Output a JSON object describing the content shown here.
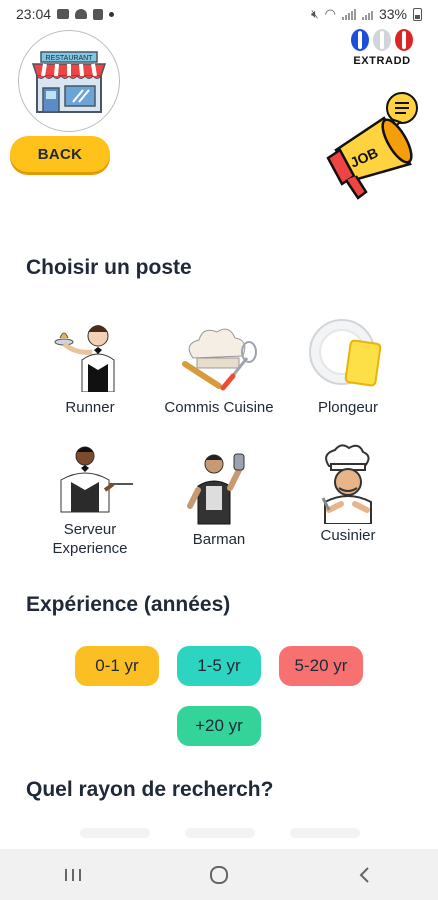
{
  "status_bar": {
    "time": "23:04",
    "battery": "33%"
  },
  "header": {
    "logo_sign": "RESTAURANT",
    "back_label": "BACK",
    "brand_name": "EXTRADD",
    "megaphone_text": "JOB"
  },
  "positions": {
    "title": "Choisir un poste",
    "items": [
      {
        "label": "Runner",
        "icon": "waiter-icon"
      },
      {
        "label": "Commis Cuisine",
        "icon": "chef-hat-utensils-icon"
      },
      {
        "label": "Plongeur",
        "icon": "plate-sponge-icon"
      },
      {
        "label": "Serveur Experience",
        "icon": "server-tray-icon"
      },
      {
        "label": "Barman",
        "icon": "bartender-shaker-icon"
      },
      {
        "label": "Cusinier",
        "icon": "cook-icon"
      }
    ]
  },
  "experience": {
    "title": "Expérience (années)",
    "options": [
      {
        "label": "0-1 yr",
        "color": "#FBBF24"
      },
      {
        "label": "1-5 yr",
        "color": "#2DD4BF"
      },
      {
        "label": "5-20 yr",
        "color": "#F87171"
      },
      {
        "label": "+20 yr",
        "color": "#34D399"
      }
    ]
  },
  "radius": {
    "title": "Quel rayon de recherch?"
  },
  "nav": {
    "icons": [
      "recent-apps-icon",
      "home-icon",
      "back-nav-icon"
    ]
  }
}
